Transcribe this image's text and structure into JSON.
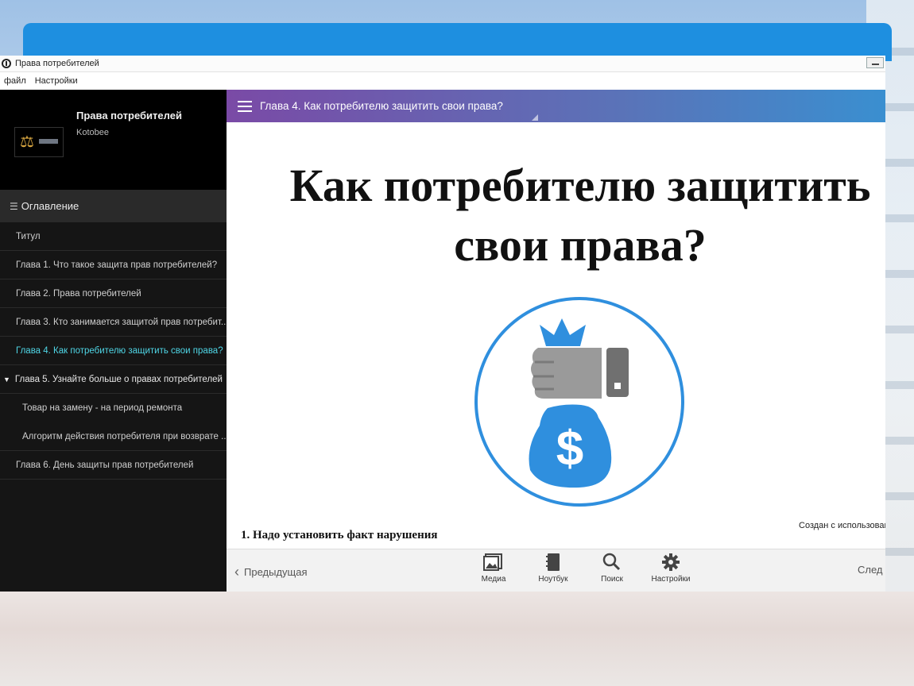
{
  "window": {
    "title": "Права потребителей"
  },
  "menu": {
    "file": "файл",
    "settings": "Настройки"
  },
  "book": {
    "title": "Права потребителей",
    "author": "Kotobee"
  },
  "toc": {
    "header": "Оглавление",
    "items": [
      {
        "label": "Титул"
      },
      {
        "label": "Глава 1. Что такое защита прав потребителей?"
      },
      {
        "label": "Глава 2. Права потребителей"
      },
      {
        "label": "Глава 3. Кто занимается защитой прав потребит..."
      },
      {
        "label": "Глава 4. Как потребителю защитить свои права?",
        "active": true
      },
      {
        "label": "Глава 5. Узнайте больше о правах потребителей",
        "expanded": true
      },
      {
        "label": "Товар на замену - на период ремонта"
      },
      {
        "label": "Алгоритм действия потребителя при возврате ..."
      },
      {
        "label": "Глава 6. День защиты прав потребителей"
      }
    ]
  },
  "reader": {
    "chapter_title": "Глава 4. Как потребителю защитить свои права?",
    "heading_line1": "Как потребителю защитить",
    "heading_line2": "свои права?",
    "creator_note": "Создан с использован",
    "section_line": "1. Надо установить факт нарушения",
    "emblem_icon": "money-bag-hand-icon",
    "accent_color": "#2f8fde"
  },
  "toolbar": {
    "prev": "Предыдущая",
    "next": "След",
    "media": "Медиа",
    "notebook": "Ноутбук",
    "search": "Поиск",
    "settings": "Настройки"
  }
}
